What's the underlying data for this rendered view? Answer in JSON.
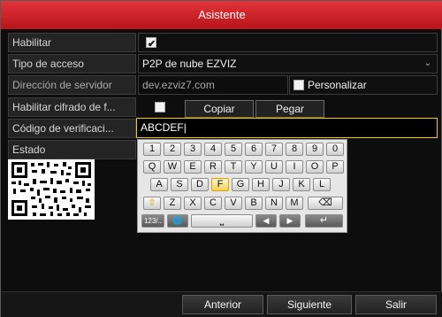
{
  "dialog": {
    "title": "Asistente"
  },
  "rows": {
    "habilitar": {
      "label": "Habilitar",
      "checked": true
    },
    "tipo_acceso": {
      "label": "Tipo de acceso",
      "value": "P2P de nube EZVIZ"
    },
    "direccion": {
      "label": "Dirección de servidor",
      "value": "dev.ezviz7.com",
      "customize_label": "Personalizar"
    },
    "cifrado": {
      "label": "Habilitar cifrado de f...",
      "copy_label": "Copiar",
      "paste_label": "Pegar"
    },
    "codigo": {
      "label": "Código de verificaci...",
      "value": "ABCDEF"
    },
    "estado": {
      "label": "Estado"
    }
  },
  "keyboard": {
    "row1": [
      "1",
      "2",
      "3",
      "4",
      "5",
      "6",
      "7",
      "8",
      "9",
      "0"
    ],
    "row2": [
      "Q",
      "W",
      "E",
      "R",
      "T",
      "Y",
      "U",
      "I",
      "O",
      "P"
    ],
    "row3": [
      "A",
      "S",
      "D",
      "F",
      "G",
      "H",
      "J",
      "K",
      "L"
    ],
    "row4": [
      "Z",
      "X",
      "C",
      "V",
      "B",
      "N",
      "M"
    ],
    "row4_extra": {
      "shift": "⇧",
      "backspace": "⌫"
    },
    "row5": {
      "mode": "123/..",
      "globe": "🌐",
      "space": "⎵",
      "left": "◀",
      "right": "▶",
      "enter": "↵"
    },
    "highlighted_key": "F"
  },
  "footer": {
    "prev_label": "Anterior",
    "next_label": "Siguiente",
    "exit_label": "Salir"
  }
}
